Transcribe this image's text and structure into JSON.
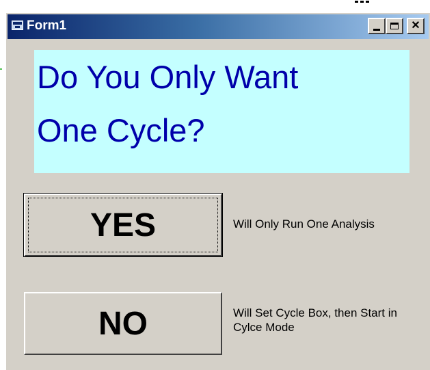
{
  "window": {
    "title": "Form1",
    "title_icon": "vb-form-icon",
    "controls": {
      "minimize": "minimize-icon",
      "maximize": "maximize-icon",
      "close_label": "✕"
    }
  },
  "header": {
    "line1": "Do You Only Want",
    "line2": "One Cycle?"
  },
  "yes": {
    "label": "YES",
    "description": "Will Only Run One Analysis"
  },
  "no": {
    "label": "NO",
    "description": "Will Set Cycle Box, then Start in Cylce Mode"
  },
  "colors": {
    "title_bar_start": "#0a246a",
    "title_bar_end": "#a6caf0",
    "header_bg": "#c4ffff",
    "header_text": "#0000aa",
    "form_bg": "#d4d0c8"
  }
}
